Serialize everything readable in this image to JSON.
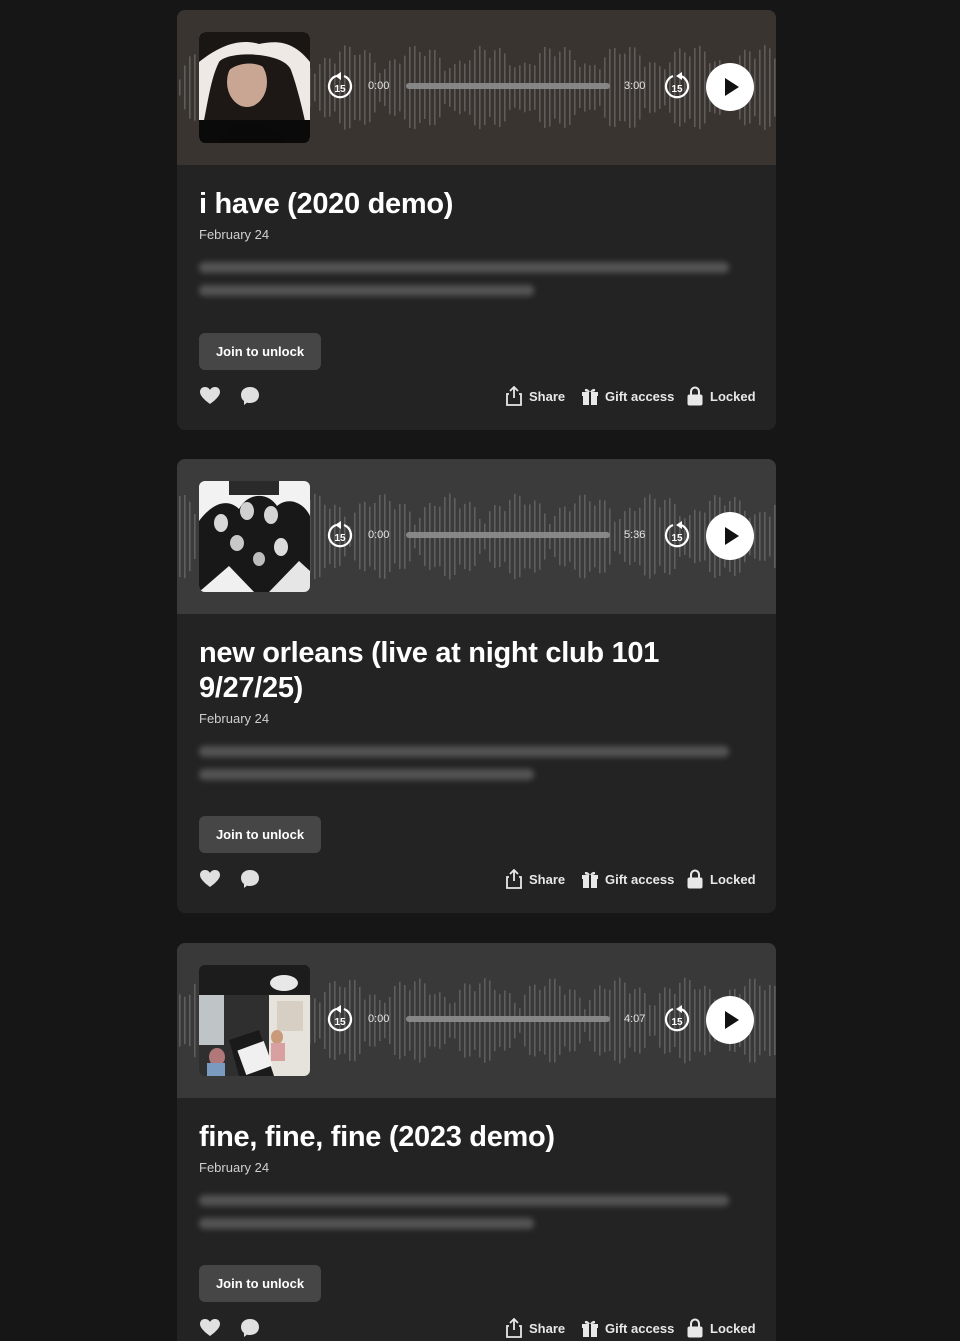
{
  "colors": {
    "background": "#161616",
    "card": "#232323",
    "button": "#464646",
    "text": "#ffffff",
    "muted": "#cfcfcf"
  },
  "posts": [
    {
      "title": "i have (2020 demo)",
      "date": "February 24",
      "player": {
        "current_time": "0:00",
        "duration": "3:00",
        "skip_back_label": "15",
        "skip_forward_label": "15"
      },
      "join_label": "Join to unlock",
      "actions": {
        "share": "Share",
        "gift": "Gift access",
        "locked": "Locked"
      }
    },
    {
      "title": "new orleans (live at night club 101 9/27/25)",
      "date": "February 24",
      "player": {
        "current_time": "0:00",
        "duration": "5:36",
        "skip_back_label": "15",
        "skip_forward_label": "15"
      },
      "join_label": "Join to unlock",
      "actions": {
        "share": "Share",
        "gift": "Gift access",
        "locked": "Locked"
      }
    },
    {
      "title": "fine, fine, fine (2023 demo)",
      "date": "February 24",
      "player": {
        "current_time": "0:00",
        "duration": "4:07",
        "skip_back_label": "15",
        "skip_forward_label": "15"
      },
      "join_label": "Join to unlock",
      "actions": {
        "share": "Share",
        "gift": "Gift access",
        "locked": "Locked"
      }
    }
  ],
  "icons": [
    "rewind-15-icon",
    "forward-15-icon",
    "play-icon",
    "heart-icon",
    "comment-icon",
    "share-icon",
    "gift-icon",
    "lock-icon"
  ]
}
